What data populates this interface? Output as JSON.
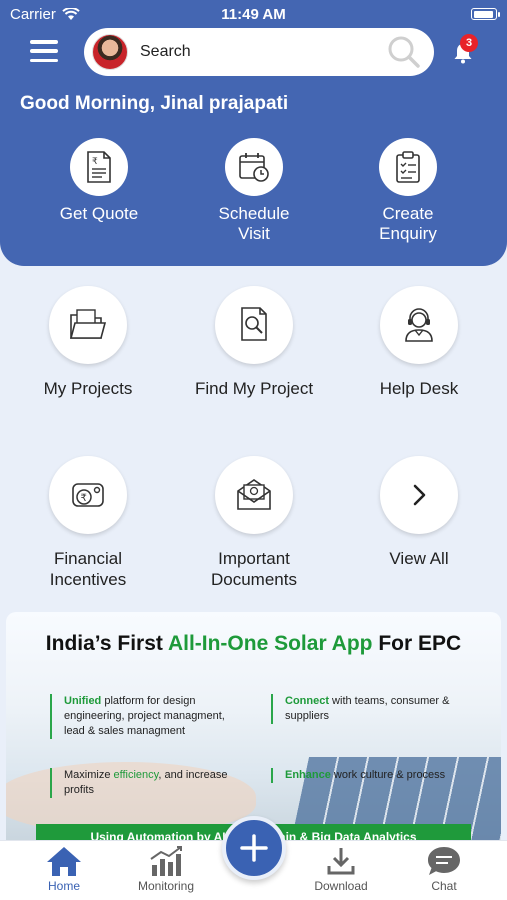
{
  "status_bar": {
    "carrier": "Carrier",
    "time": "11:49 AM"
  },
  "header": {
    "search_placeholder": "Search",
    "notification_count": "3",
    "greeting": "Good Morning, Jinal prajapati",
    "quick_actions": [
      {
        "label": "Get Quote",
        "icon": "quote-document-icon"
      },
      {
        "label": "Schedule\nVisit",
        "icon": "calendar-clock-icon"
      },
      {
        "label": "Create\nEnquiry",
        "icon": "clipboard-icon"
      }
    ]
  },
  "tiles": [
    {
      "label": "My Projects",
      "icon": "folder-icon"
    },
    {
      "label": "Find My Project",
      "icon": "document-search-icon"
    },
    {
      "label": "Help Desk",
      "icon": "support-agent-icon"
    },
    {
      "label": "Financial\nIncentives",
      "icon": "wallet-rupee-icon"
    },
    {
      "label": "Important\nDocuments",
      "icon": "envelope-icon"
    },
    {
      "label": "View All",
      "icon": "chevron-right-icon"
    }
  ],
  "banner": {
    "title_prefix": "India’s First ",
    "title_highlight": "All-In-One Solar App",
    "title_suffix": " For EPC",
    "bullets": [
      {
        "highlight": "Unified",
        "text": " platform for design engineering, project managment, lead & sales managment"
      },
      {
        "highlight": "Connect",
        "text": " with teams, consumer & suppliers"
      },
      {
        "prefix": "Maximize ",
        "highlight": "efficiency",
        "text": ", and increase profits"
      },
      {
        "highlight": "Enhance",
        "text": " work culture & process"
      }
    ],
    "footer_text": "Using Automation by AI, Blockchain & Big Data Analytics"
  },
  "bottom_nav": {
    "items": [
      {
        "label": "Home",
        "icon": "home-icon",
        "active": true
      },
      {
        "label": "Monitoring",
        "icon": "chart-icon"
      },
      {
        "label": "Download",
        "icon": "download-icon"
      },
      {
        "label": "Chat",
        "icon": "chat-icon"
      }
    ],
    "fab_icon": "plus-icon"
  },
  "colors": {
    "primary": "#4466b2",
    "accent_green": "#1e9a3a",
    "badge_red": "#e8232a"
  }
}
